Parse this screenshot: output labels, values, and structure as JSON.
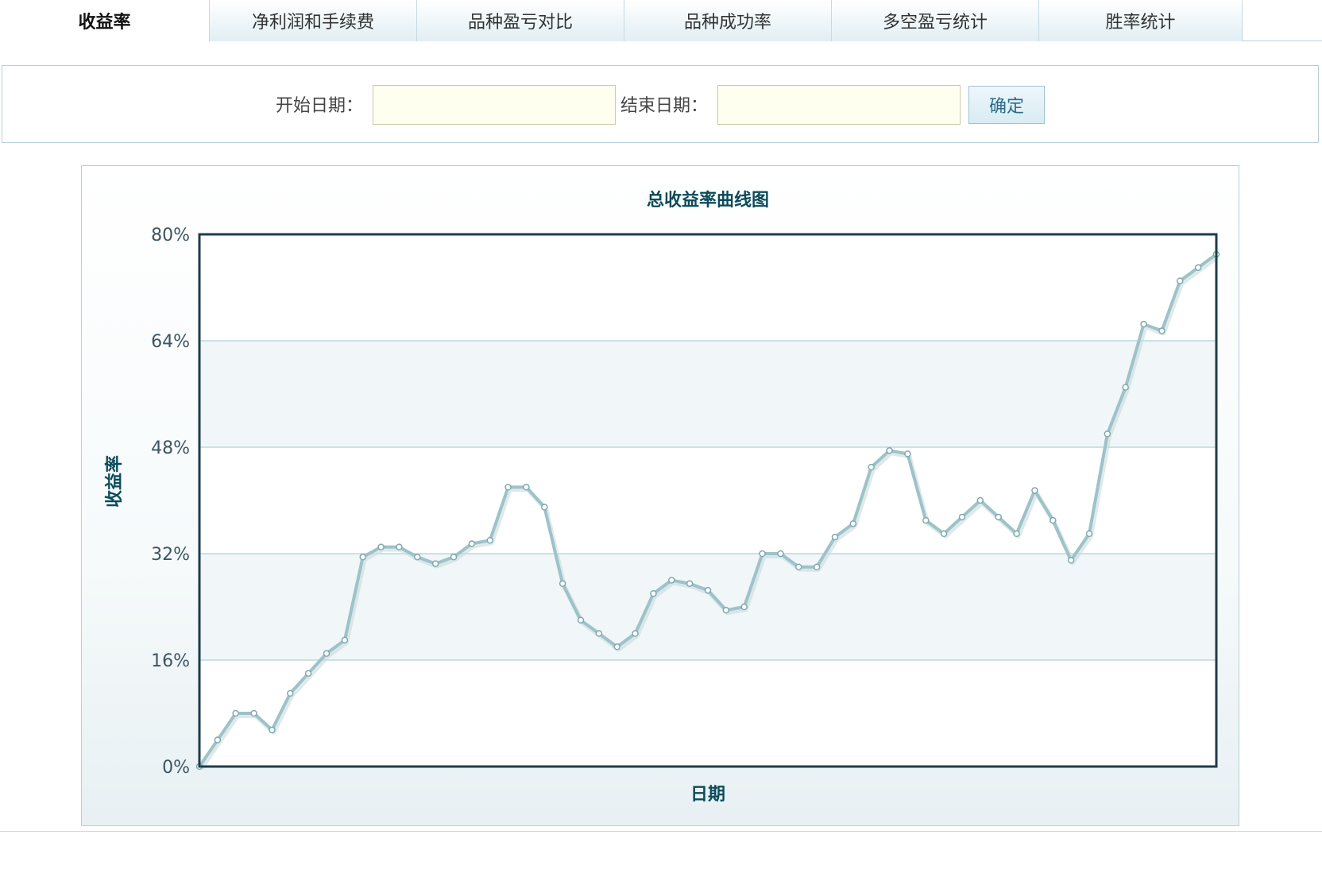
{
  "tabs": [
    {
      "label": "收益率",
      "active": true
    },
    {
      "label": "净利润和手续费",
      "active": false
    },
    {
      "label": "品种盈亏对比",
      "active": false
    },
    {
      "label": "品种成功率",
      "active": false
    },
    {
      "label": "多空盈亏统计",
      "active": false
    },
    {
      "label": "胜率统计",
      "active": false
    }
  ],
  "filter": {
    "start_label": "开始日期：",
    "end_label": "结束日期：",
    "start_value": "",
    "end_value": "",
    "confirm_label": "确定"
  },
  "colors": {
    "line": "#9cc3c9",
    "axis": "#1e3c4c",
    "title": "#0b4b5a",
    "grid": "#bcd8de",
    "band": "#f1f6f8",
    "tick": "#3d5560",
    "input_bg": "#fffff0"
  },
  "chart_data": {
    "type": "line",
    "title": "总收益率曲线图",
    "xlabel": "日期",
    "ylabel": "收益率",
    "ylim": [
      0,
      80
    ],
    "y_ticks": [
      "0%",
      "16%",
      "32%",
      "48%",
      "64%",
      "80%"
    ],
    "grid": true,
    "legend": "none",
    "series": [
      {
        "values": [
          0,
          4,
          8,
          8,
          5.5,
          11,
          14,
          17,
          19,
          31.5,
          33,
          33,
          31.5,
          30.5,
          31.5,
          33.5,
          34,
          42,
          42,
          39,
          27.5,
          22,
          20,
          18,
          20,
          26,
          28,
          27.5,
          26.5,
          23.5,
          24,
          32,
          32,
          30,
          30,
          34.5,
          36.5,
          45,
          47.5,
          47,
          37,
          35,
          37.5,
          40,
          37.5,
          35,
          41.5,
          37,
          31,
          35,
          50,
          57,
          66.5,
          65.5,
          73,
          75,
          77
        ]
      }
    ]
  }
}
